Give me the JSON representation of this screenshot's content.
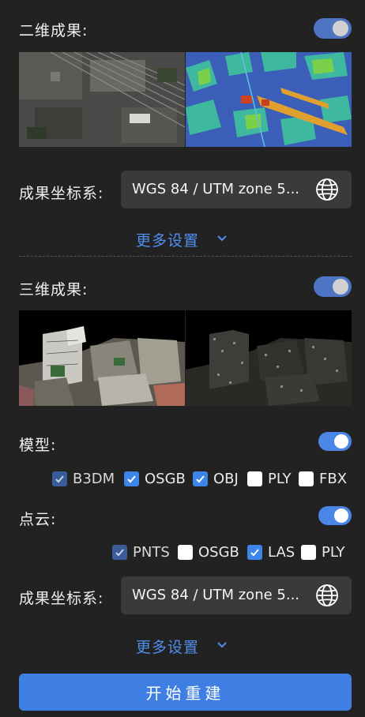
{
  "section2d": {
    "title": "二维成果:",
    "toggle_on": true,
    "crs_label": "成果坐标系:",
    "crs_value": "WGS 84 / UTM zone 5...",
    "more_label": "更多设置"
  },
  "section3d": {
    "title": "三维成果:",
    "toggle_on": true,
    "model": {
      "label": "模型:",
      "toggle_on": true,
      "formats": [
        {
          "label": "B3DM",
          "checked": true,
          "disabled": true
        },
        {
          "label": "OSGB",
          "checked": true
        },
        {
          "label": "OBJ",
          "checked": true
        },
        {
          "label": "PLY",
          "checked": false
        },
        {
          "label": "FBX",
          "checked": false
        }
      ]
    },
    "pointcloud": {
      "label": "点云:",
      "toggle_on": true,
      "formats": [
        {
          "label": "PNTS",
          "checked": true,
          "disabled": true
        },
        {
          "label": "OSGB",
          "checked": false
        },
        {
          "label": "LAS",
          "checked": true
        },
        {
          "label": "PLY",
          "checked": false
        }
      ]
    },
    "crs_label": "成果坐标系:",
    "crs_value": "WGS 84 / UTM zone 5...",
    "more_label": "更多设置"
  },
  "start_button": "开始重建",
  "colors": {
    "accent": "#4a86e8",
    "link": "#4f8ff0",
    "background": "#222222"
  }
}
